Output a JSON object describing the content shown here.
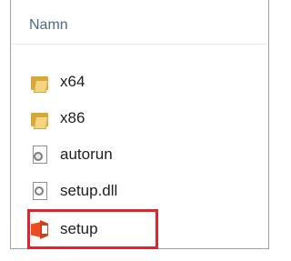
{
  "column_header": {
    "label": "Namn"
  },
  "files": [
    {
      "name": "x64",
      "type": "folder",
      "icon": "folder-icon"
    },
    {
      "name": "x86",
      "type": "folder",
      "icon": "folder-icon"
    },
    {
      "name": "autorun",
      "type": "setup-information",
      "icon": "config-file-icon"
    },
    {
      "name": "setup.dll",
      "type": "application-extension",
      "icon": "dll-file-icon"
    },
    {
      "name": "setup",
      "type": "application",
      "icon": "office-setup-icon",
      "highlighted": true
    }
  ],
  "colors": {
    "highlight_border": "#e1252e",
    "header_text": "#4d6a86"
  }
}
